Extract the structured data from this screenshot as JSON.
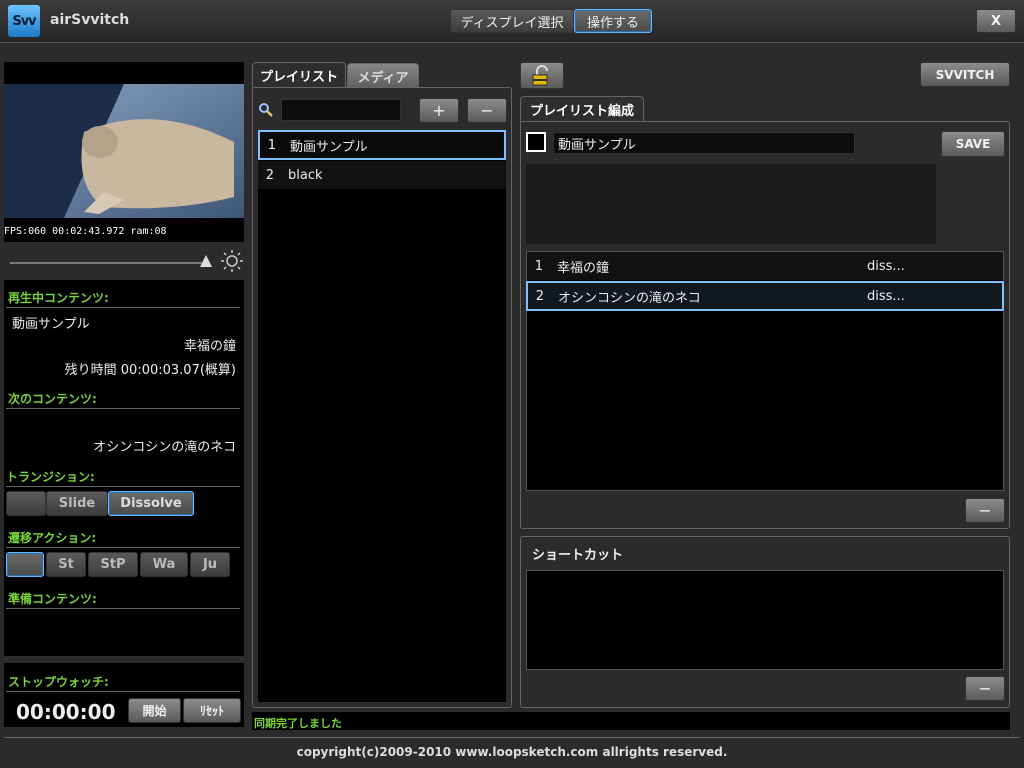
{
  "app": {
    "logo_text": "Svv",
    "title": "airSvvitch"
  },
  "header": {
    "display_select_label": "ディスプレイ選択",
    "operate_label": "操作する",
    "close_label": "X"
  },
  "preview": {
    "osd_text": "FPS:060 00:02:43.972 ram:08"
  },
  "status": {
    "now_playing_heading": "再生中コンテンツ:",
    "now_playing_playlist": "動画サンプル",
    "now_playing_item": "幸福の鐘",
    "remaining": "残り時間 00:00:03.07(概算)",
    "next_heading": "次のコンテンツ:",
    "next_item": "オシンコシンの滝のネコ",
    "transition_heading": "トランジション:",
    "transition_buttons": [
      "",
      "Slide",
      "Dissolve"
    ],
    "action_heading": "遷移アクション:",
    "action_buttons": [
      "",
      "St",
      "StP",
      "Wa",
      "Ju"
    ],
    "prepared_heading": "準備コンテンツ:"
  },
  "stopwatch": {
    "heading": "ストップウォッチ:",
    "time": "00:00:00",
    "start_label": "開始",
    "reset_label": "ﾘｾｯﾄ"
  },
  "left_tabs": {
    "playlist": "プレイリスト",
    "media": "メディア"
  },
  "playlist_panel": {
    "search_value": "",
    "add_label": "+",
    "remove_label": "−",
    "items": [
      {
        "num": "1",
        "name": "動画サンプル"
      },
      {
        "num": "2",
        "name": "black"
      }
    ]
  },
  "status_message": "同期完了しました",
  "right_top": {
    "svvitch_label": "SVVITCH"
  },
  "editor": {
    "tab": "プレイリスト編成",
    "name_value": "動画サンプル",
    "save_label": "SAVE",
    "items": [
      {
        "num": "1",
        "name": "幸福の鐘",
        "transition": "diss..."
      },
      {
        "num": "2",
        "name": "オシンコシンの滝のネコ",
        "transition": "diss..."
      }
    ],
    "remove_label": "−"
  },
  "shortcut": {
    "heading": "ショートカット",
    "remove_label": "−"
  },
  "footer": {
    "copyright": "copyright(c)2009-2010 www.loopsketch.com allrights reserved."
  },
  "colors": {
    "accent": "#6ab7ff",
    "label_green": "#7bd43a",
    "panel_bg": "#2b2b2b"
  }
}
